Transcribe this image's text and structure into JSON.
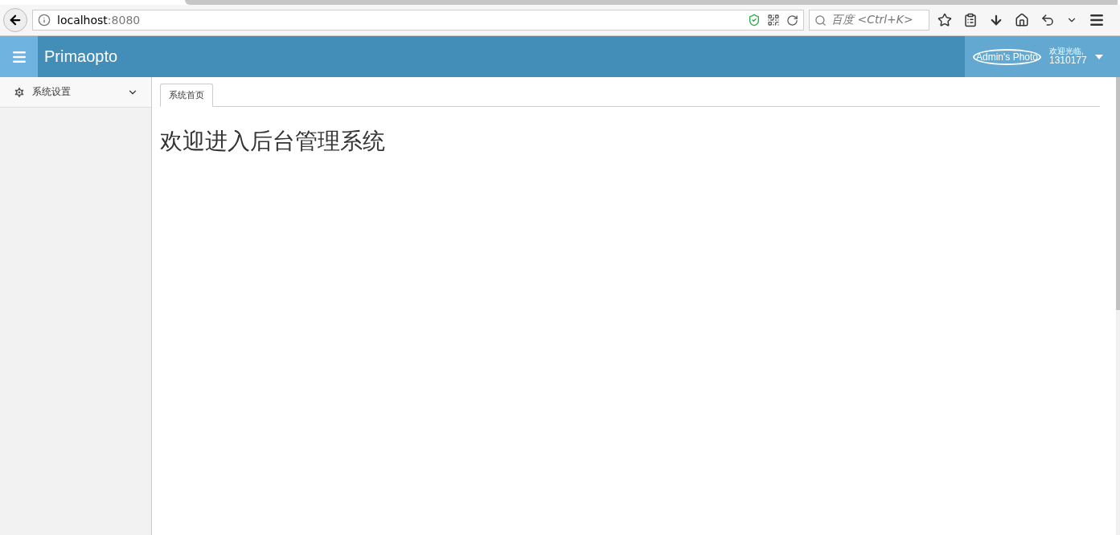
{
  "browser": {
    "url_host": "localhost",
    "url_port": ":8080",
    "search_placeholder": "百度 <Ctrl+K>"
  },
  "header": {
    "brand": "Primaopto",
    "avatar_alt": "Admin's Photo",
    "greeting": "欢迎光临,",
    "user_id": "1310177"
  },
  "sidebar": {
    "items": [
      {
        "label": "系统设置",
        "expanded": false
      }
    ]
  },
  "tabs": [
    {
      "label": "系统首页",
      "selected": true
    }
  ],
  "content": {
    "heading": "欢迎进入后台管理系统"
  }
}
